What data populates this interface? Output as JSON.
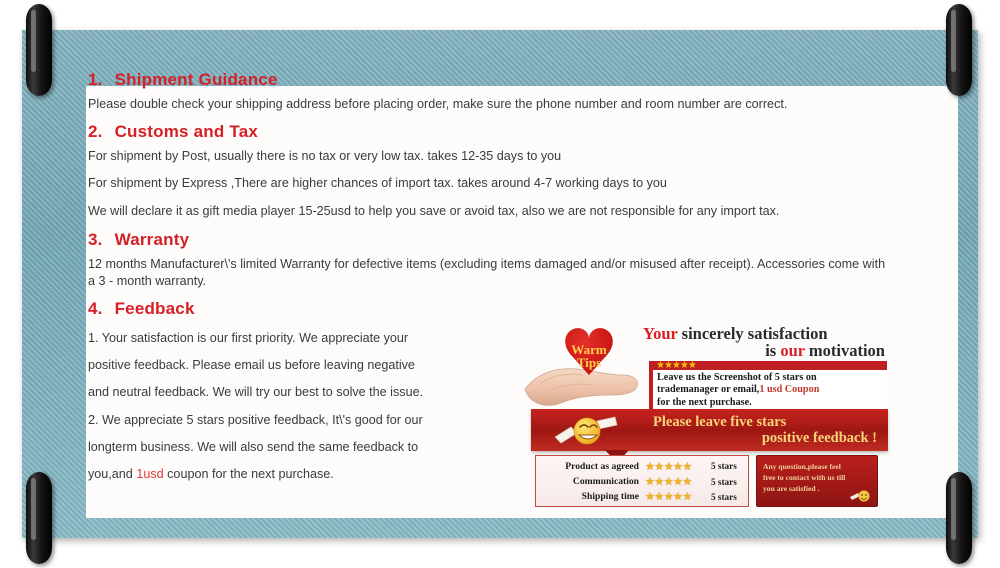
{
  "sections": [
    {
      "num": "1.",
      "title": "Shipment Guidance",
      "paragraphs": [
        "Please double check your shipping address before placing order, make sure the phone number and room number are correct."
      ]
    },
    {
      "num": "2.",
      "title": "Customs and Tax",
      "paragraphs": [
        "For shipment by Post, usually there is no tax or very low tax. takes 12-35 days to you",
        "For shipment by Express ,There are higher chances of import tax. takes around 4-7 working days to you",
        "We will declare it as gift media player 15-25usd to help you save or avoid tax, also we are not responsible for any import tax."
      ]
    },
    {
      "num": "3.",
      "title": "Warranty",
      "paragraphs": [
        "12 months Manufacturer\\'s limited Warranty for defective items (excluding items damaged and/or misused after receipt). Accessories come with a 3 - month warranty."
      ]
    },
    {
      "num": "4.",
      "title": "Feedback",
      "lines": [
        "1. Your satisfaction is our first priority. We appreciate your",
        "positive feedback. Please email us before leaving negative",
        "and neutral feedback. We will try our best to solve the issue.",
        "2. We appreciate 5 stars positive feedback, It\\'s good for our",
        "longterm business. We will also send the same feedback to"
      ],
      "last_line_pre": "you,and ",
      "last_line_highlight": "1usd",
      "last_line_post": " coupon for the next purchase."
    }
  ],
  "promo": {
    "heart_label_line1": "Warm",
    "heart_label_line2": "Tips",
    "sincerely": {
      "line1_red": "Your",
      "line1_dark": " sincerely satisfaction",
      "line2_dark_a": "is ",
      "line2_red": "our",
      "line2_dark_b": " motivation"
    },
    "screenshot_box": {
      "stars": "★★★★★",
      "line1": "Leave us the Screenshot of 5 stars on",
      "line2_a": "trademanager or email,",
      "line2_red": "1 usd Coupon",
      "line3": "for the next purchase."
    },
    "ribbon": {
      "line1": "Please leave five stars",
      "line2": "positive feedback !"
    },
    "rating_table": {
      "rows": [
        {
          "label": "Product as agreed",
          "stars": "★★★★★",
          "value": "5 stars"
        },
        {
          "label": "Communication",
          "stars": "★★★★★",
          "value": "5 stars"
        },
        {
          "label": "Shipping time",
          "stars": "★★★★★",
          "value": "5 stars"
        }
      ]
    },
    "question_box": {
      "line1": "Any question,please feel",
      "line2": "free to contact with us till",
      "line3": "you are satisfied ."
    }
  },
  "colors": {
    "heading_red": "#d52027",
    "frame_teal": "#7fb0bd",
    "ribbon_red": "#b81f1c",
    "star_gold": "#f0b429",
    "body_text": "#3b3b3b"
  }
}
